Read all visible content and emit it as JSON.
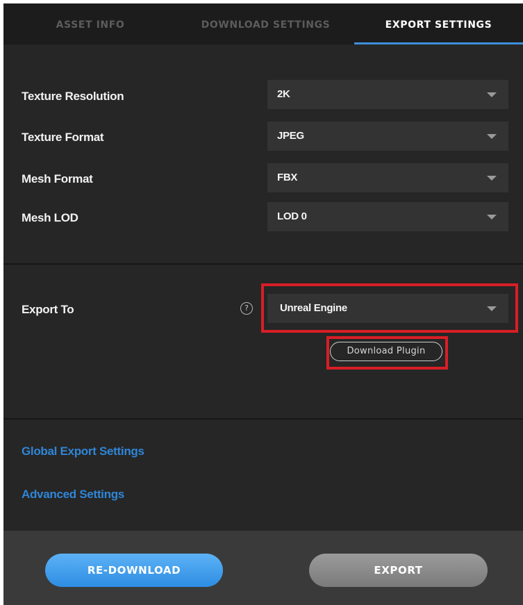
{
  "tabs": [
    {
      "label": "ASSET INFO",
      "active": false
    },
    {
      "label": "DOWNLOAD SETTINGS",
      "active": false
    },
    {
      "label": "EXPORT SETTINGS",
      "active": true
    }
  ],
  "settings": [
    {
      "label": "Texture Resolution",
      "value": "2K"
    },
    {
      "label": "Texture Format",
      "value": "JPEG"
    },
    {
      "label": "Mesh Format",
      "value": "FBX"
    },
    {
      "label": "Mesh LOD",
      "value": "LOD 0"
    }
  ],
  "export_to": {
    "label": "Export To",
    "help_icon": "?",
    "value": "Unreal Engine",
    "plugin_button": "Download Plugin"
  },
  "links": {
    "global_export": "Global Export Settings",
    "advanced": "Advanced Settings"
  },
  "footer": {
    "redownload": "RE-DOWNLOAD",
    "export": "EXPORT"
  },
  "colors": {
    "accent": "#2f86d8",
    "highlight": "#d81e25",
    "panel_bg": "#262626"
  }
}
